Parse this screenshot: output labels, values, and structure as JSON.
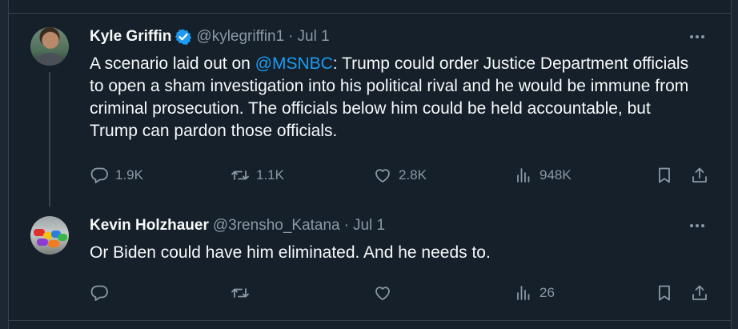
{
  "tweets": [
    {
      "author_name": "Kyle Griffin",
      "verified": true,
      "handle": "@kylegriffin1",
      "separator": "·",
      "date": "Jul 1",
      "text_before": "A scenario laid out on ",
      "mention": "@MSNBC",
      "text_after": ": Trump could order Justice Department officials to open a sham investigation into his political rival and he would be immune from criminal prosecution. The officials below him could be held accountable, but Trump can pardon those officials.",
      "replies": "1.9K",
      "reposts": "1.1K",
      "likes": "2.8K",
      "views": "948K"
    },
    {
      "author_name": "Kevin Holzhauer",
      "verified": false,
      "handle": "@3rensho_Katana",
      "separator": "·",
      "date": "Jul 1",
      "text": "Or Biden could have him eliminated. And he needs to.",
      "replies": "",
      "reposts": "",
      "likes": "",
      "views": "26"
    }
  ],
  "icons": {
    "more": "more-horizontal-icon",
    "reply": "reply-bubble-icon",
    "repost": "repost-arrows-icon",
    "like": "heart-icon",
    "views": "bar-chart-icon",
    "bookmark": "bookmark-icon",
    "share": "share-upload-icon",
    "verified": "verified-badge-icon"
  },
  "colors": {
    "background": "#15202b",
    "text": "#f7f9f9",
    "secondary": "#8b98a5",
    "accent": "#1d9bf0",
    "divider": "#38444d"
  }
}
